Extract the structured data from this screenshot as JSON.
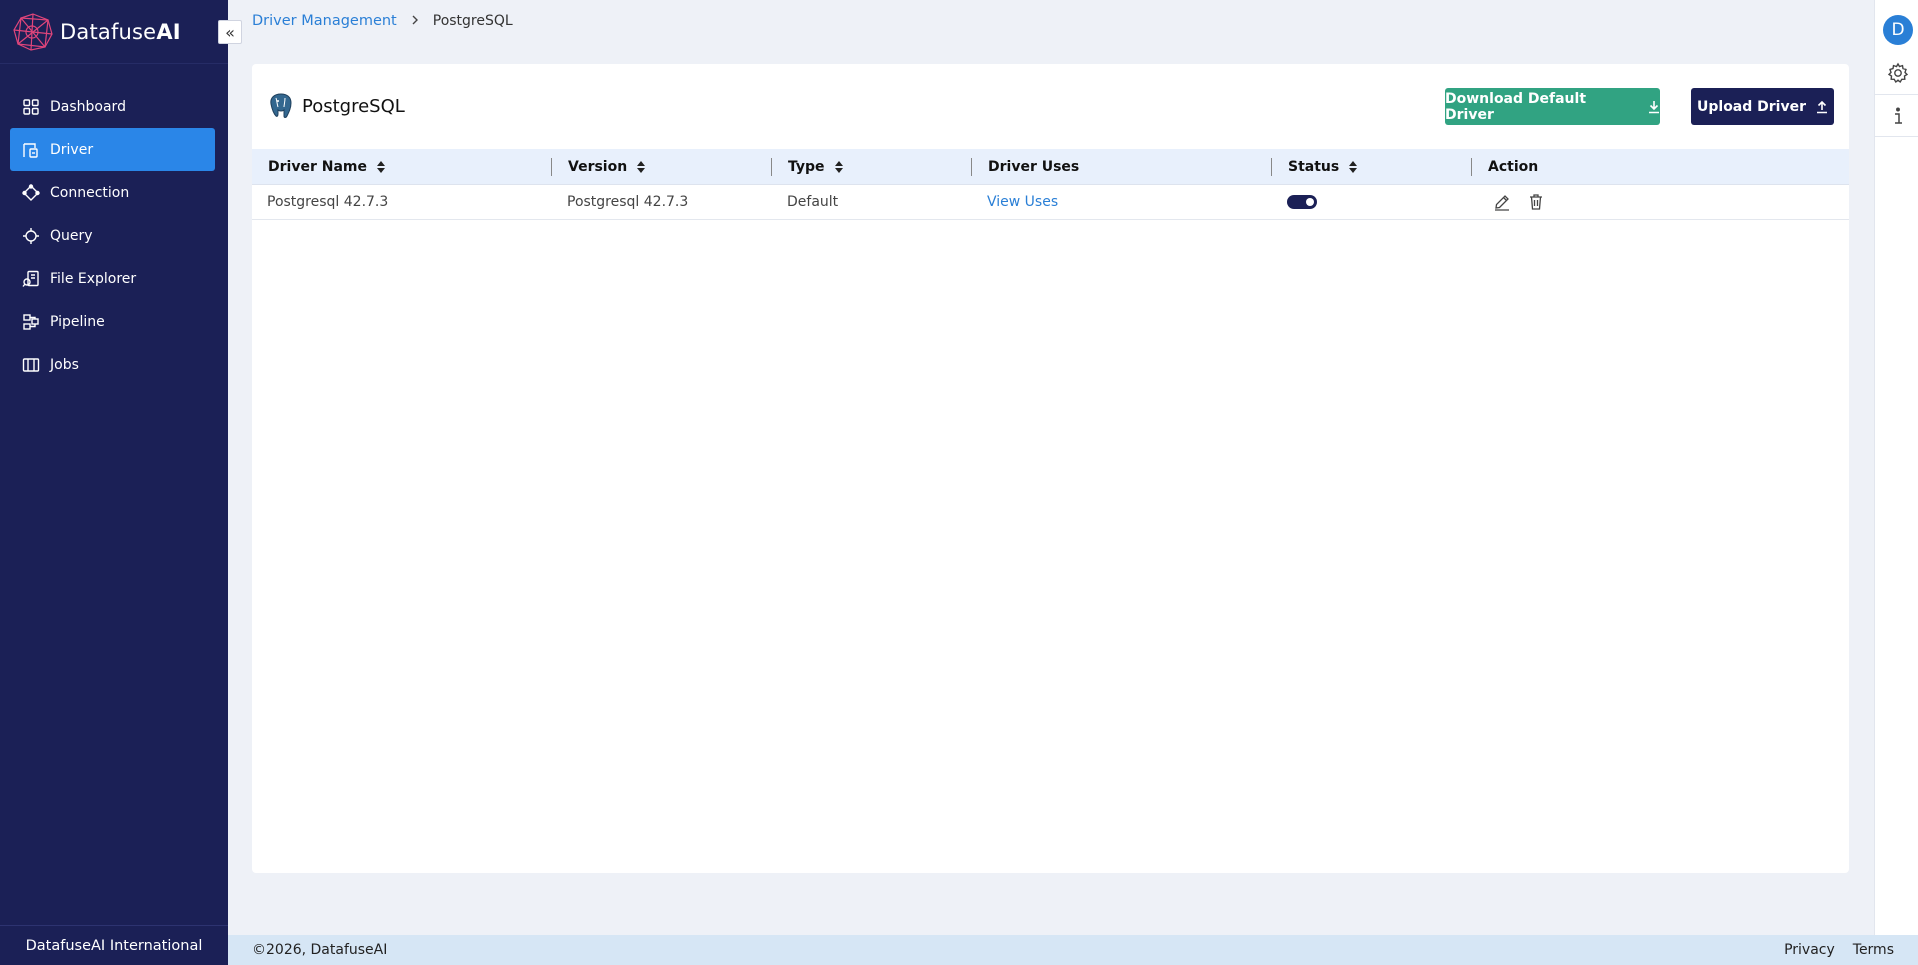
{
  "app": {
    "brand_name": "Datafuse",
    "brand_suffix": "AI"
  },
  "sidebar": {
    "collapse_icon": "double-chevron-left-icon",
    "items": [
      {
        "label": "Dashboard",
        "icon": "grid-icon",
        "active": false
      },
      {
        "label": "Driver",
        "icon": "driver-icon",
        "active": true
      },
      {
        "label": "Connection",
        "icon": "connection-icon",
        "active": false
      },
      {
        "label": "Query",
        "icon": "query-icon",
        "active": false
      },
      {
        "label": "File Explorer",
        "icon": "file-search-icon",
        "active": false
      },
      {
        "label": "Pipeline",
        "icon": "pipeline-icon",
        "active": false
      },
      {
        "label": "Jobs",
        "icon": "jobs-icon",
        "active": false
      }
    ],
    "footer_text": "DatafuseAI International"
  },
  "breadcrumb": {
    "parent": "Driver Management",
    "current": "PostgreSQL"
  },
  "card": {
    "title": "PostgreSQL",
    "download_button": "Download Default Driver",
    "upload_button": "Upload Driver"
  },
  "table": {
    "columns": [
      "Driver Name",
      "Version",
      "Type",
      "Driver Uses",
      "Status",
      "Action"
    ],
    "rows": [
      {
        "driver_name": "Postgresql 42.7.3",
        "version": "Postgresql 42.7.3",
        "type": "Default",
        "driver_uses": "View Uses",
        "status_enabled": true
      }
    ]
  },
  "right_rail": {
    "avatar_letter": "D",
    "icons": [
      "gear-icon",
      "info-icon"
    ]
  },
  "footer": {
    "copyright": "©2026, DatafuseAI",
    "links": [
      "Privacy",
      "Terms"
    ]
  },
  "colors": {
    "sidebar_bg": "#1b2056",
    "active_item": "#2a86e8",
    "download_button": "#31a382",
    "upload_button": "#1b2056",
    "link": "#2a7fd6",
    "table_header_bg": "#e8f0fc"
  }
}
